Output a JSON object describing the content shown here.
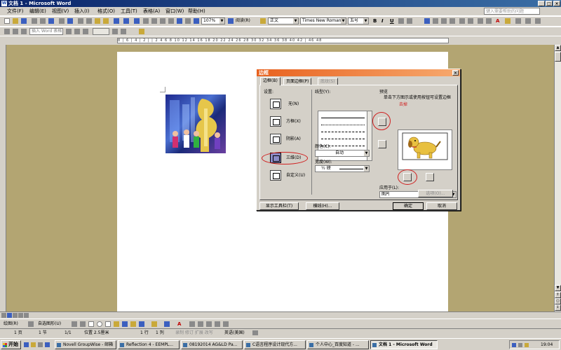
{
  "window": {
    "title": "文档 1 - Microsoft Word",
    "app_icon": "W"
  },
  "menu": [
    "文件(F)",
    "编辑(E)",
    "视图(V)",
    "插入(I)",
    "格式(O)",
    "工具(T)",
    "表格(A)",
    "窗口(W)",
    "帮助(H)"
  ],
  "help_box": "键入需要帮助的问题",
  "toolbar": {
    "zoom": "107%",
    "read_button": "阅读(R)",
    "style": "正文",
    "font": "Times New Roman",
    "size": "五号",
    "bold": "B",
    "italic": "I",
    "underline": "U",
    "font_color": "A",
    "toolbar2_label": "插入 Word 表格"
  },
  "ruler_text": "8 | 6 | 4 | 2 | | 2 4 6 8 10 12 14 16 18 20 22 24 26 28 30 32 34 36 38 40 42 | 46 48",
  "dialog": {
    "title": "边框",
    "tabs": [
      "边框(B)",
      "页面边框(P)",
      "底纹(S)"
    ],
    "setting_label": "设置:",
    "settings": [
      "无(N)",
      "方框(X)",
      "阴影(A)",
      "三维(D)",
      "自定义(U)"
    ],
    "line_style_label": "线型(Y):",
    "color_label": "颜色(C):",
    "color_value": "自动",
    "width_label": "宽度(W):",
    "width_value": "½ 磅",
    "preview_label": "预览",
    "preview_hint": "单击下方图示或使用按钮可设置边框",
    "annotation": "去掉",
    "apply_to_label": "应用于(L):",
    "apply_to_value": "图片",
    "options_button": "选项(O)...",
    "show_toolbar_button": "显示工具栏(T)",
    "hline_button": "横线(H)...",
    "ok_button": "确定",
    "cancel_button": "取消"
  },
  "drawing_toolbar": {
    "draw_label": "绘图(R)",
    "autoshapes_label": "自选图形(U)"
  },
  "status_bar": {
    "page": "1 页",
    "section": "1 节",
    "page_of": "1/1",
    "position": "位置 2.5厘米",
    "line": "1 行",
    "column": "1 列",
    "flags": "录制 修订 扩展 改写",
    "language": "英语(美国)"
  },
  "taskbar": {
    "start": "开始",
    "tasks": [
      "Novell GroupWise - 邮箱",
      "Reflection 4 - EEMPL...",
      "08192014 AG&LD Pa...",
      "C语言程序设计现代方...",
      "个人中心_百度知道 - ...",
      "文档 1 - Microsoft Word"
    ],
    "clock": "19:04"
  }
}
